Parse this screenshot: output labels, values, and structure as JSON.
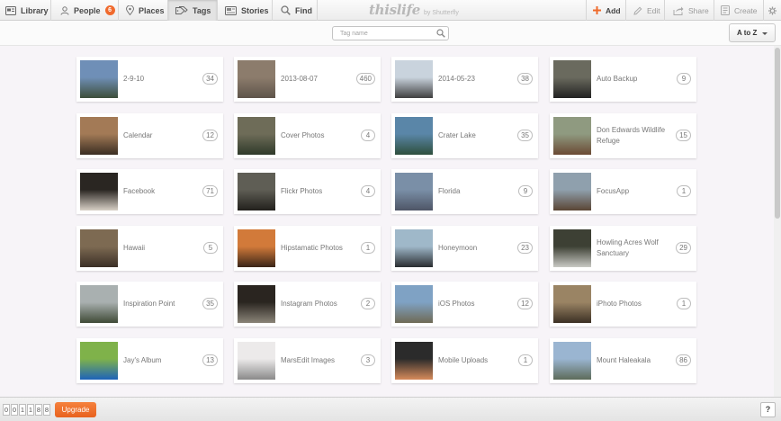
{
  "nav": {
    "library": "Library",
    "people": "People",
    "people_badge": "6",
    "places": "Places",
    "tags": "Tags",
    "stories": "Stories",
    "find": "Find"
  },
  "brand": {
    "name": "thislife",
    "by": "by Shutterfly"
  },
  "actions": {
    "add": "Add",
    "edit": "Edit",
    "share": "Share",
    "create": "Create"
  },
  "search": {
    "placeholder": "Tag name"
  },
  "sort": {
    "label": "A to Z"
  },
  "tags": [
    {
      "label": "2-9-10",
      "count": "34"
    },
    {
      "label": "2013-08-07",
      "count": "460"
    },
    {
      "label": "2014-05-23",
      "count": "38"
    },
    {
      "label": "Auto Backup",
      "count": "9"
    },
    {
      "label": "Calendar",
      "count": "12"
    },
    {
      "label": "Cover Photos",
      "count": "4"
    },
    {
      "label": "Crater Lake",
      "count": "35"
    },
    {
      "label": "Don Edwards Wildlife Refuge",
      "count": "15"
    },
    {
      "label": "Facebook",
      "count": "71"
    },
    {
      "label": "Flickr Photos",
      "count": "4"
    },
    {
      "label": "Florida",
      "count": "9"
    },
    {
      "label": "FocusApp",
      "count": "1"
    },
    {
      "label": "Hawaii",
      "count": "5"
    },
    {
      "label": "Hipstamatic Photos",
      "count": "1"
    },
    {
      "label": "Honeymoon",
      "count": "23"
    },
    {
      "label": "Howling Acres Wolf Sanctuary",
      "count": "29"
    },
    {
      "label": "Inspiration Point",
      "count": "35"
    },
    {
      "label": "Instagram Photos",
      "count": "2"
    },
    {
      "label": "iOS Photos",
      "count": "12"
    },
    {
      "label": "iPhoto Photos",
      "count": "1"
    },
    {
      "label": "Jay's Album",
      "count": "13"
    },
    {
      "label": "MarsEdit Images",
      "count": "3"
    },
    {
      "label": "Mobile Uploads",
      "count": "1"
    },
    {
      "label": "Mount Haleakala",
      "count": "86"
    }
  ],
  "thumb_colors": [
    [
      "#6f8fb7",
      "#3d4e3a"
    ],
    [
      "#8c7c6c",
      "#5e544a"
    ],
    [
      "#c9d3dd",
      "#3f3f3f"
    ],
    [
      "#6a6a5e",
      "#222222"
    ],
    [
      "#a37a56",
      "#3a2d22"
    ],
    [
      "#6e6c58",
      "#2f3a2a"
    ],
    [
      "#5a86a8",
      "#2e4f3d"
    ],
    [
      "#8f9a80",
      "#6b4a34"
    ],
    [
      "#2a2622",
      "#d8d0c6"
    ],
    [
      "#5f5e55",
      "#22201c"
    ],
    [
      "#7a8fa7",
      "#4e5566"
    ],
    [
      "#8fa0ad",
      "#5a4534"
    ],
    [
      "#7d6a52",
      "#3b2f26"
    ],
    [
      "#d27a3a",
      "#3a2518"
    ],
    [
      "#9fb8c9",
      "#2a2d30"
    ],
    [
      "#3d4034",
      "#c8c9c4"
    ],
    [
      "#a9b0b0",
      "#3f4a36"
    ],
    [
      "#2a2520",
      "#8a8478"
    ],
    [
      "#7fa2c4",
      "#6f6a55"
    ],
    [
      "#9a8464",
      "#3c3024"
    ],
    [
      "#7fb24a",
      "#1e63b9"
    ],
    [
      "#eceaea",
      "#8a8a8a"
    ],
    [
      "#2b2b2b",
      "#d68a5a"
    ],
    [
      "#9ab5d1",
      "#5d6b5a"
    ]
  ],
  "counter_digits": [
    "0",
    "0",
    "1",
    "1",
    "8",
    "8"
  ],
  "bottom": {
    "upgrade": "Upgrade",
    "help": "?"
  }
}
